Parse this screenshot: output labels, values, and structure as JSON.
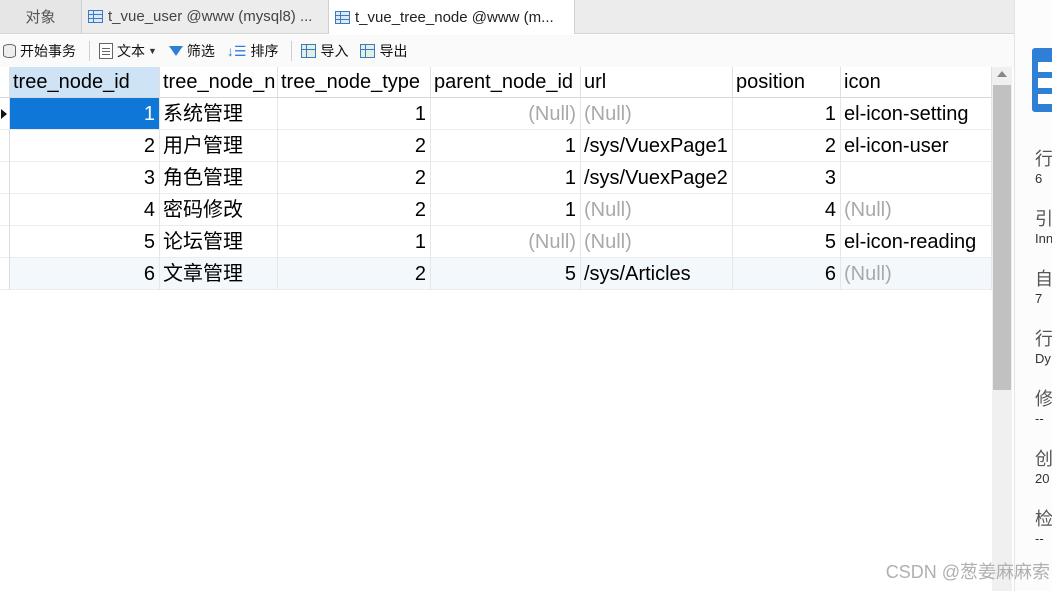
{
  "tabs": [
    {
      "label": "对象"
    },
    {
      "label": "t_vue_user @www (mysql8) ..."
    },
    {
      "label": "t_vue_tree_node @www (m..."
    }
  ],
  "toolbar": {
    "begin_transaction": "开始事务",
    "text": "文本",
    "filter": "筛选",
    "sort": "排序",
    "import": "导入",
    "export": "导出"
  },
  "table": {
    "columns": [
      "tree_node_id",
      "tree_node_n",
      "tree_node_type",
      "parent_node_id",
      "url",
      "position",
      "icon"
    ],
    "rows": [
      [
        "1",
        "系统管理",
        "1",
        "(Null)",
        "(Null)",
        "1",
        "el-icon-setting"
      ],
      [
        "2",
        "用户管理",
        "2",
        "1",
        "/sys/VuexPage1",
        "2",
        "el-icon-user"
      ],
      [
        "3",
        "角色管理",
        "2",
        "1",
        "/sys/VuexPage2",
        "3",
        ""
      ],
      [
        "4",
        "密码修改",
        "2",
        "1",
        "(Null)",
        "4",
        "(Null)"
      ],
      [
        "5",
        "论坛管理",
        "1",
        "(Null)",
        "(Null)",
        "5",
        "el-icon-reading"
      ],
      [
        "6",
        "文章管理",
        "2",
        "5",
        "/sys/Articles",
        "6",
        "(Null)"
      ]
    ]
  },
  "info_panel": [
    {
      "k": "行",
      "v": "6"
    },
    {
      "k": "引",
      "v": "Inn"
    },
    {
      "k": "自",
      "v": "7"
    },
    {
      "k": "行",
      "v": "Dy"
    },
    {
      "k": "修",
      "v": "--"
    },
    {
      "k": "创",
      "v": "20"
    },
    {
      "k": "检",
      "v": "--"
    }
  ],
  "watermark": "CSDN @葱姜麻麻索",
  "colors": {
    "selection": "#0f77d7",
    "header_selected": "#cfe3f7",
    "null_text": "#a9a9a9",
    "accent": "#2f7fd6"
  },
  "icons": [
    "table-icon",
    "begin-transaction-icon",
    "text-icon",
    "filter-icon",
    "sort-icon",
    "import-icon",
    "export-icon",
    "row-pointer-icon",
    "panel-icon"
  ]
}
